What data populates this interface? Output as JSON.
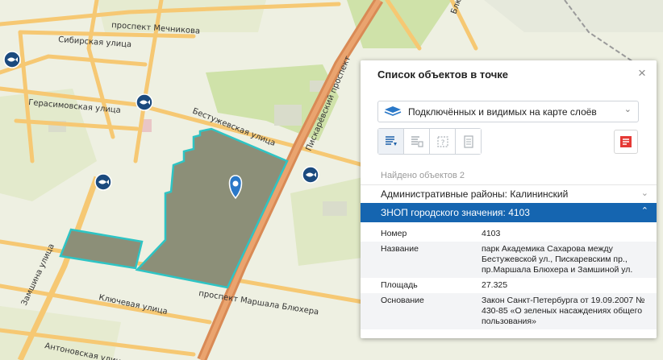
{
  "map": {
    "streets": {
      "mechnikova": "проспект Мечникова",
      "sibirskaya": "Сибирская улица",
      "gerasimovskaya": "Герасимовская улица",
      "bestuzhevskaya": "Бестужевская улица",
      "piskarevsky": "Пискарёвский проспект",
      "zamshina": "Замшина улица",
      "klyuchevaya": "Ключевая улица",
      "marshala_blyukhera": "проспект Маршала Блюхера",
      "antonovskaya": "Антоновская улица",
      "blyukhera_short": "Блюхера"
    }
  },
  "panel": {
    "title": "Список объектов в точке",
    "close": "×",
    "layer_select": {
      "value": "Подключённых и видимых на карте слоёв",
      "chevron": "⌄"
    },
    "toolbar": {
      "icons": [
        "list-filter-icon",
        "table-icon",
        "help-icon",
        "document-icon"
      ]
    },
    "pdf_icon": "pdf-export-icon",
    "found_text": "Найдено объектов 2",
    "groups": [
      {
        "label": "Административные районы: Калининский",
        "chevron": "⌄"
      },
      {
        "label": "ЗНОП городского значения: 4103",
        "chevron": "⌃"
      }
    ],
    "properties": [
      {
        "key": "Номер",
        "value": "4103"
      },
      {
        "key": "Название",
        "value": "парк Академика Сахарова между Бестужевской ул., Пискаревским пр., пр.Маршала Блюхера и Замшиной ул."
      },
      {
        "key": "Площадь",
        "value": "27.325"
      },
      {
        "key": "Основание",
        "value": "Закон Санкт-Петербурга от 19.09.2007 № 430-85 «О зеленых насаждениях общего пользования»"
      }
    ]
  },
  "colors": {
    "accent": "#1565b0",
    "polygon_fill": "#8c8f78",
    "polygon_stroke": "#2ec4c4",
    "road_main": "#e08a4a",
    "road_minor": "#f6c873",
    "transit_marker": "#1b4a7e",
    "pin": "#2a78c8"
  }
}
